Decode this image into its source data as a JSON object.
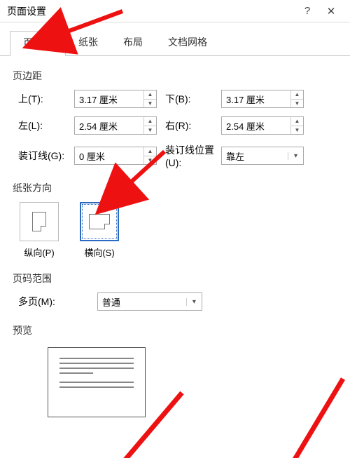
{
  "titlebar": {
    "title": "页面设置",
    "help": "?",
    "close": "✕"
  },
  "tabs": {
    "margins": "页边距",
    "paper": "纸张",
    "layout": "布局",
    "docgrid": "文档网格"
  },
  "margins": {
    "heading": "页边距",
    "topLabel": "上(T):",
    "topValue": "3.17 厘米",
    "bottomLabel": "下(B):",
    "bottomValue": "3.17 厘米",
    "leftLabel": "左(L):",
    "leftValue": "2.54 厘米",
    "rightLabel": "右(R):",
    "rightValue": "2.54 厘米",
    "gutterLabel": "装订线(G):",
    "gutterValue": "0 厘米",
    "gutterPosLabel": "装订线位置(U):",
    "gutterPosValue": "靠左"
  },
  "orientation": {
    "heading": "纸张方向",
    "portrait": "纵向(P)",
    "landscape": "横向(S)"
  },
  "pagerange": {
    "heading": "页码范围",
    "multiLabel": "多页(M):",
    "multiValue": "普通"
  },
  "preview": {
    "heading": "预览"
  }
}
